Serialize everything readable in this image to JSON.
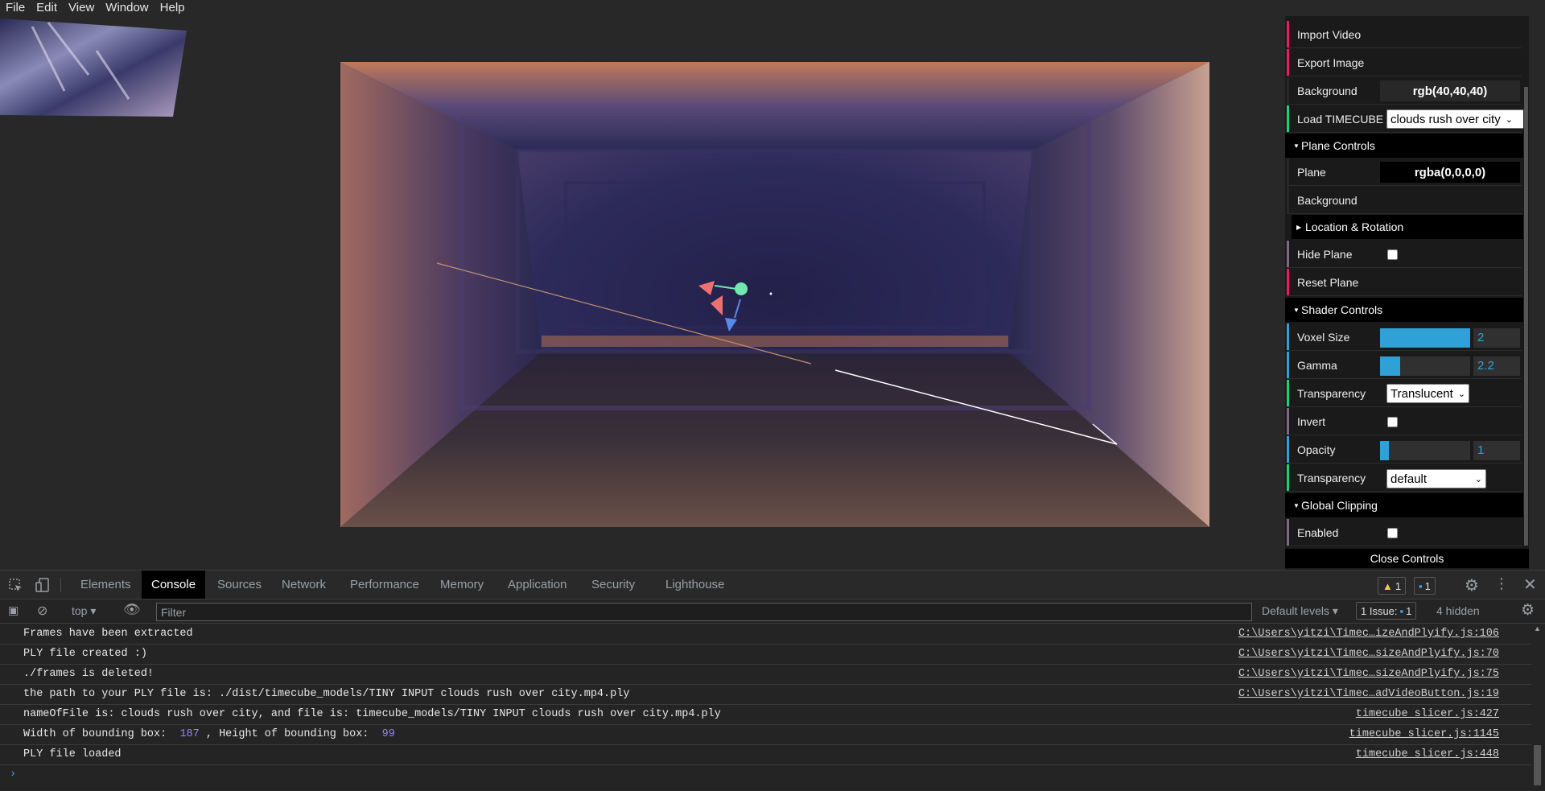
{
  "menubar": [
    "File",
    "Edit",
    "View",
    "Window",
    "Help"
  ],
  "panel": {
    "import_video": "Import Video",
    "export_image": "Export Image",
    "background_label": "Background",
    "background_value": "rgb(40,40,40)",
    "load_timecube_label": "Load TIMECUBE",
    "load_timecube_value": "clouds rush over city",
    "plane_controls": "Plane Controls",
    "plane_label": "Plane",
    "plane_value": "rgba(0,0,0,0)",
    "plane_background_label": "Background",
    "location_rotation": "Location & Rotation",
    "hide_plane": "Hide Plane",
    "reset_plane": "Reset Plane",
    "shader_controls": "Shader Controls",
    "voxel_size_label": "Voxel Size",
    "voxel_size_value": "2",
    "voxel_size_fraction": 1.0,
    "gamma_label": "Gamma",
    "gamma_value": "2.2",
    "gamma_fraction": 0.22,
    "transparency_label": "Transparency",
    "transparency_value": "Translucent",
    "invert_label": "Invert",
    "opacity_label": "Opacity",
    "opacity_value": "1",
    "opacity_fraction": 0.1,
    "transparency2_label": "Transparency",
    "transparency2_value": "default",
    "global_clipping": "Global Clipping",
    "enabled_label": "Enabled",
    "close_controls": "Close Controls"
  },
  "devtools": {
    "tabs": [
      "Elements",
      "Console",
      "Sources",
      "Network",
      "Performance",
      "Memory",
      "Application",
      "Security",
      "Lighthouse"
    ],
    "active_tab": "Console",
    "warnings_count": "1",
    "messages_count": "1",
    "context": "top",
    "filter_placeholder": "Filter",
    "levels": "Default levels",
    "issues_label": "1 Issue:",
    "issues_count": "1",
    "hidden": "4 hidden",
    "lines": [
      {
        "msg": "Frames have been extracted",
        "src": "C:\\Users\\yitzi\\Timec…izeAndPlyify.js:106"
      },
      {
        "msg": "PLY file created :)",
        "src": "C:\\Users\\yitzi\\Timec…sizeAndPlyify.js:70"
      },
      {
        "msg": "./frames is deleted!",
        "src": "C:\\Users\\yitzi\\Timec…sizeAndPlyify.js:75"
      },
      {
        "msg": "the path to your PLY file is: ./dist/timecube_models/TINY INPUT clouds rush over city.mp4.ply",
        "src": "C:\\Users\\yitzi\\Timec…adVideoButton.js:19"
      },
      {
        "msg": "nameOfFile is: clouds rush over city, and file is: timecube_models/TINY INPUT clouds rush over city.mp4.ply",
        "src": "timecube_slicer.js:427"
      },
      {
        "msg_a": "Width of bounding box: ",
        "num_a": "187",
        "msg_b": " , Height of bounding box: ",
        "num_b": "99",
        "src": "timecube_slicer.js:1145"
      },
      {
        "msg": "PLY file loaded",
        "src": "timecube_slicer.js:448"
      }
    ],
    "prompt": "›"
  },
  "colors": {
    "background": "#282828",
    "accent_blue": "#2fa1d6",
    "bar_red": "#e61d5f",
    "bar_green": "#1ed36f",
    "bar_blue": "#2fa1d6",
    "bar_gray": "#806787"
  }
}
